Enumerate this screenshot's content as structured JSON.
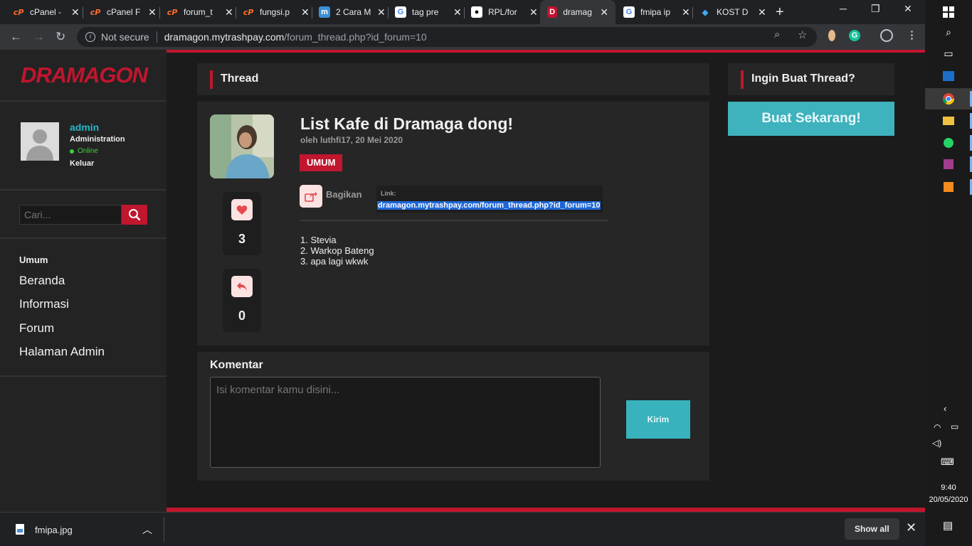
{
  "tabs": [
    {
      "title": "cPanel -",
      "icon": "cpanel-icon"
    },
    {
      "title": "cPanel F",
      "icon": "cpanel-icon"
    },
    {
      "title": "forum_t",
      "icon": "cpanel-icon"
    },
    {
      "title": "fungsi.p",
      "icon": "cpanel-icon"
    },
    {
      "title": "2 Cara M",
      "icon": "m-icon"
    },
    {
      "title": "tag pre",
      "icon": "google-icon"
    },
    {
      "title": "RPL/for",
      "icon": "github-icon"
    },
    {
      "title": "dramag",
      "icon": "dramagon-icon"
    },
    {
      "title": "fmipa ip",
      "icon": "google-icon"
    },
    {
      "title": "KOST D",
      "icon": "kost-icon"
    }
  ],
  "address": {
    "security": "Not secure",
    "host": "dramagon.mytrashpay.com",
    "path": "/forum_thread.php?id_forum=10"
  },
  "sidebar": {
    "logo_text": "DRAMAGON",
    "user": {
      "name": "admin",
      "role": "Administration",
      "status": "Online",
      "logout": "Keluar"
    },
    "search_placeholder": "Cari...",
    "nav_heading": "Umum",
    "nav_items": [
      "Beranda",
      "Informasi",
      "Forum",
      "Halaman Admin"
    ]
  },
  "thread": {
    "header": "Thread",
    "title": "List Kafe di Dramaga dong!",
    "meta": "oleh luthfi17, 20 Mei 2020",
    "tag": "UMUM",
    "likes": "3",
    "replies": "0",
    "share_label": "Bagikan",
    "link_label": "Link:",
    "link_url": "dramagon.mytrashpay.com/forum_thread.php?id_forum=10",
    "body": [
      "1. Stevia",
      "2. Warkop Bateng",
      "3. apa lagi wkwk"
    ]
  },
  "comment": {
    "title": "Komentar",
    "placeholder": "Isi komentar kamu disini...",
    "submit": "Kirim"
  },
  "cta": {
    "header": "Ingin Buat Thread?",
    "button": "Buat Sekarang!"
  },
  "downloads": {
    "file": "fmipa.jpg",
    "show_all": "Show all"
  },
  "taskbar": {
    "time": "9:40",
    "date": "20/05/2020"
  },
  "colors": {
    "brand_red": "#c0162e",
    "accent_teal": "#3eb2bd",
    "online_green": "#3bd23b"
  }
}
